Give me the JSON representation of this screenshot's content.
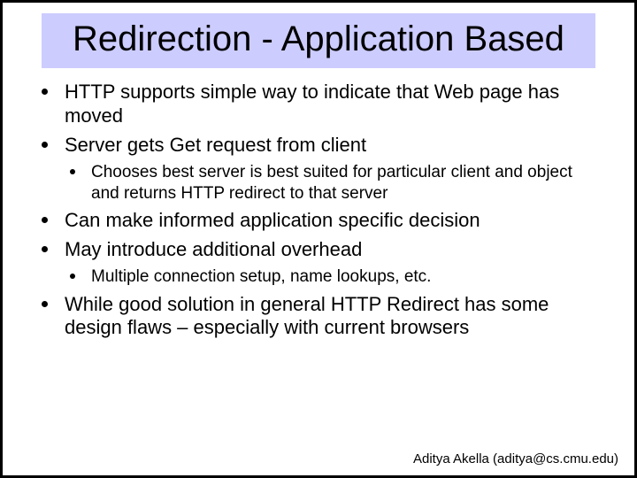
{
  "title": "Redirection - Application Based",
  "bullets": {
    "b1": "HTTP supports simple way to indicate that Web page has moved",
    "b2": "Server gets Get request from client",
    "b2_1": "Chooses best server is best suited for particular client and object and returns HTTP redirect to that server",
    "b3": "Can make informed application specific decision",
    "b4": "May introduce additional overhead",
    "b4_1": "Multiple connection setup, name lookups, etc.",
    "b5": "While good solution in general HTTP Redirect has some design flaws – especially with current browsers"
  },
  "footer": "Aditya Akella (aditya@cs.cmu.edu)"
}
